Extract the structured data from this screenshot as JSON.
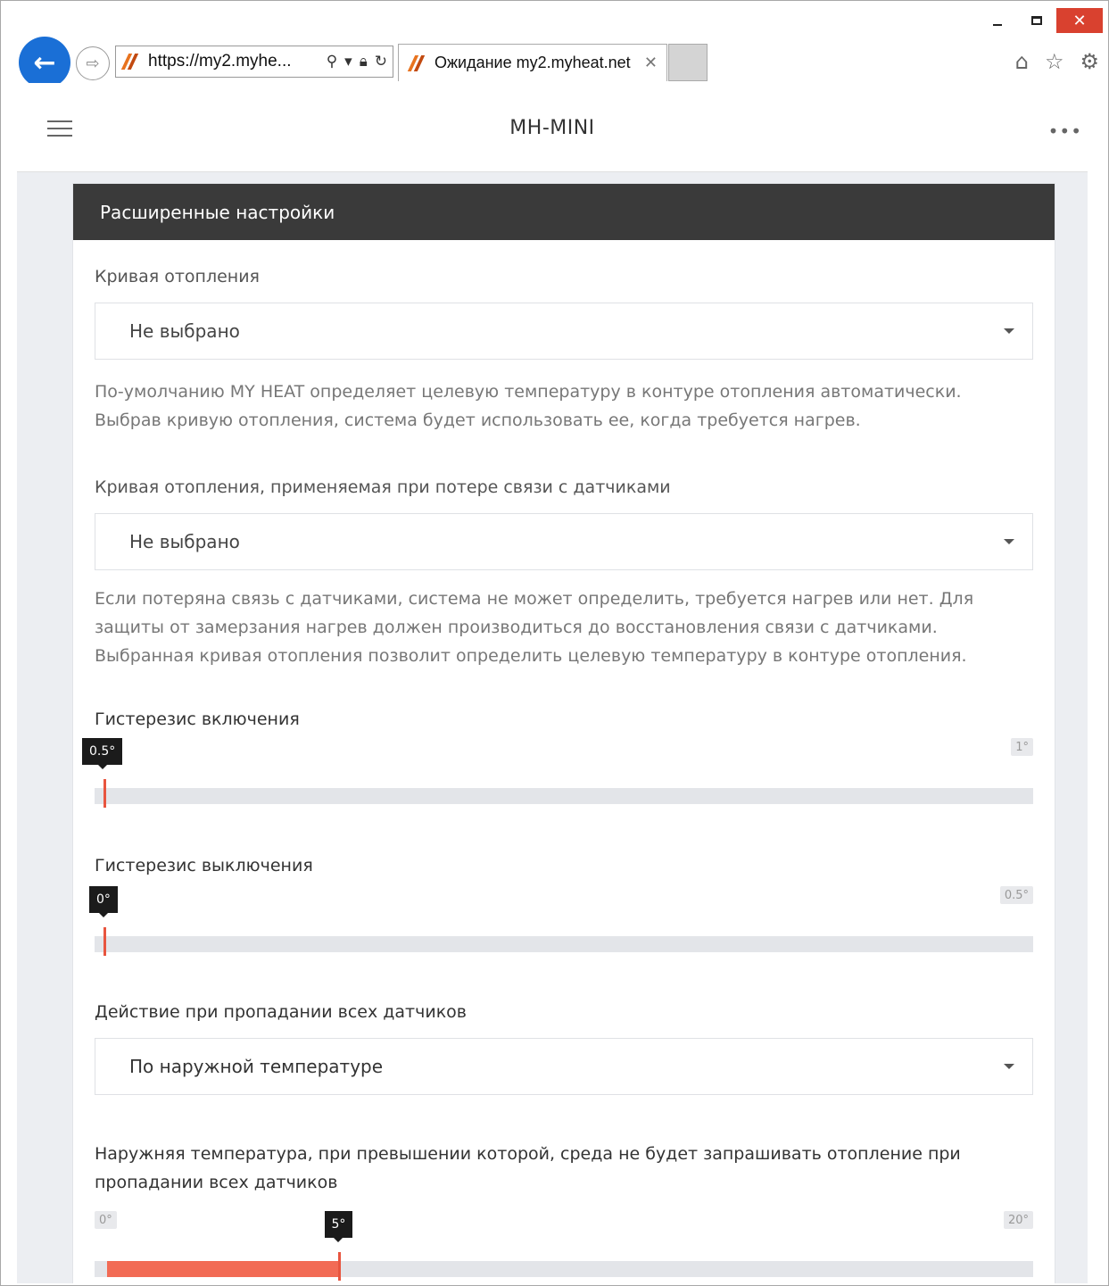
{
  "browser": {
    "address": "https://my2.myhe...",
    "tab_title": "Ожидание my2.myheat.net",
    "controls": {
      "minimize": "",
      "maximize": "",
      "close": "✕"
    }
  },
  "header": {
    "title": "MH-MINI",
    "more": "•••"
  },
  "card": {
    "title": "Расширенные настройки"
  },
  "heating_curve": {
    "label": "Кривая отопления",
    "value": "Не выбрано",
    "help": "По-умолчанию MY HEAT определяет целевую температуру в контуре отопления автоматически. Выбрав кривую отопления, система будет использовать ее, когда требуется нагрев."
  },
  "fallback_curve": {
    "label": "Кривая отопления, применяемая при потере связи с датчиками",
    "value": "Не выбрано",
    "help": "Если потеряна связь с датчиками, система не может определить, требуется нагрев или нет. Для защиты от замерзания нагрев должен производиться до восстановления связи с датчиками. Выбранная кривая отопления позволит определить целевую температуру в контуре отопления."
  },
  "hyst_on": {
    "label": "Гистерезис включения",
    "value": "0.5°",
    "max": "1°",
    "fraction": 0.0
  },
  "hyst_off": {
    "label": "Гистерезис выключения",
    "value": "0°",
    "max": "0.5°",
    "fraction": 0.0
  },
  "sensor_loss": {
    "label": "Действие при пропадании всех датчиков",
    "value": "По наружной температуре"
  },
  "outdoor_threshold": {
    "label": "Наружняя температура, при превышении которой, среда не будет запрашивать отопление при пропадании всех датчиков",
    "min": "0°",
    "value": "5°",
    "max": "20°",
    "fraction": 0.25
  }
}
